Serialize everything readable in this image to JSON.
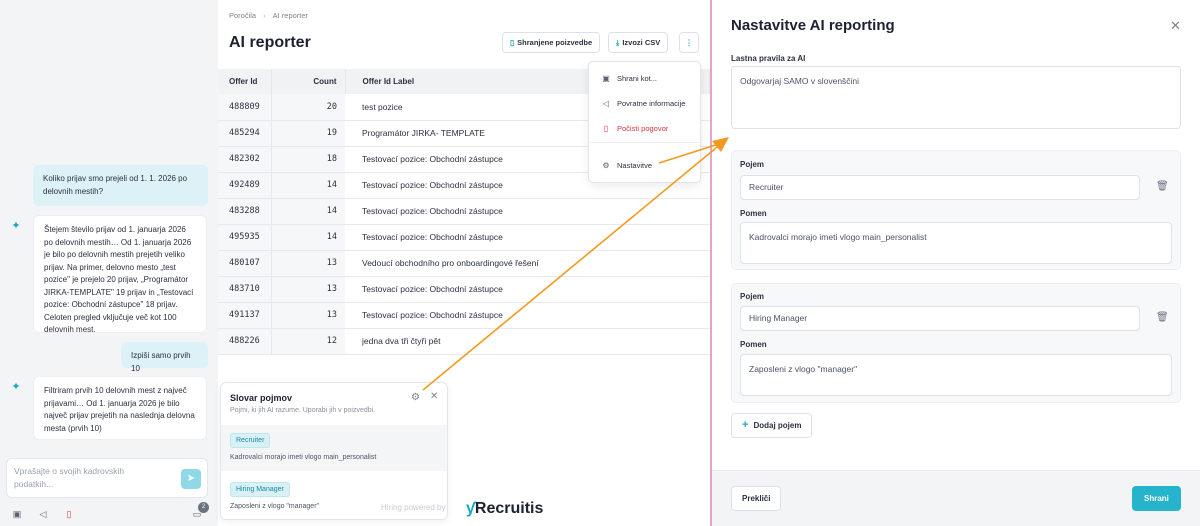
{
  "breadcrumb": {
    "parent": "Poročila",
    "current": "AI reporter"
  },
  "page": {
    "title": "AI reporter"
  },
  "toolbar": {
    "saved_queries_label": "Shranjene poizvedbe",
    "export_label": "Izvozi CSV",
    "more_icon": "kebab-menu-icon"
  },
  "menu": {
    "items": [
      {
        "label": "Shrani kot...",
        "icon": "save-icon"
      },
      {
        "label": "Povratne informacije",
        "icon": "megaphone-icon"
      },
      {
        "label": "Počisti pogovor",
        "icon": "trash-icon"
      },
      {
        "label": "Nastavitve",
        "icon": "gear-icon"
      }
    ],
    "danger_color": "#d9363e"
  },
  "table": {
    "headers": [
      "Offer Id",
      "Count",
      "Offer Id Label"
    ],
    "rows": [
      [
        "488809",
        "20",
        "test pozice"
      ],
      [
        "485294",
        "19",
        "Programátor JIRKA- TEMPLATE"
      ],
      [
        "482302",
        "18",
        "Testovací pozice: Obchodní zástupce"
      ],
      [
        "492489",
        "14",
        "Testovací pozice: Obchodní zástupce"
      ],
      [
        "483288",
        "14",
        "Testovací pozice: Obchodní zástupce"
      ],
      [
        "495935",
        "14",
        "Testovací pozice: Obchodní zástupce"
      ],
      [
        "480107",
        "13",
        "Vedoucí obchodního pro onboardingové řešení"
      ],
      [
        "483710",
        "13",
        "Testovací pozice: Obchodní zástupce"
      ],
      [
        "491137",
        "13",
        "Testovací pozice: Obchodní zástupce"
      ],
      [
        "488226",
        "12",
        "jedna dva tři čtyři pět"
      ]
    ]
  },
  "chat": {
    "messages": [
      {
        "role": "user",
        "text": "Koliko prijav smo prejeli od 1. 1. 2026 po delovnih mestih?"
      },
      {
        "role": "ai",
        "text": "Štejem število prijav od 1. januarja 2026 po delovnih mestih… Od 1. januarja 2026 je bilo po delovnih mestih prejetih veliko prijav. Na primer, delovno mesto „test pozice\" je prejelo 20 prijav, „Programátor JIRKA-TEMPLATE\" 19 prijav in „Testovací pozice: Obchodní zástupce\" 18 prijav. Celoten pregled vključuje več kot 100 delovnih mest."
      },
      {
        "role": "user",
        "text": "Izpiši samo prvih 10"
      },
      {
        "role": "ai",
        "text": "Filtriram prvih 10 delovnih mest z največ prijavami… Od 1. januarja 2026 je bilo največ prijav prejetih na naslednja delovna mesta (prvih 10)"
      }
    ],
    "input_placeholder": "Vprašajte o svojih kadrovskih podatkih...",
    "badge_count": "2"
  },
  "glossary": {
    "title": "Slovar pojmov",
    "subtitle": "Pojmi, ki jih AI razume. Uporabi jih v poizvedbi.",
    "items": [
      {
        "term": "Recruiter",
        "meaning": "Kadrovalci morajo imeti vlogo main_personalist"
      },
      {
        "term": "Hiring Manager",
        "meaning": "Zaposleni z vlogo \"manager\""
      }
    ]
  },
  "branding": {
    "powered": "Hiring powered by",
    "logo": "Recruitis"
  },
  "settings": {
    "title": "Nastavitve AI reporting",
    "rules_label": "Lastna pravila za AI",
    "rules_value": "Odgovarjaj SAMO v slovenščini",
    "term_label": "Pojem",
    "meaning_label": "Pomen",
    "terms": [
      {
        "term": "Recruiter",
        "meaning": "Kadrovalci morajo imeti vlogo main_personalist"
      },
      {
        "term": "Hiring Manager",
        "meaning": "Zaposleni z vlogo \"manager\""
      }
    ],
    "add_term_label": "Dodaj pojem",
    "cancel_label": "Prekliči",
    "save_label": "Shrani"
  },
  "colors": {
    "accent": "#25b4cc",
    "annotation_arrow": "#f39a1e"
  }
}
